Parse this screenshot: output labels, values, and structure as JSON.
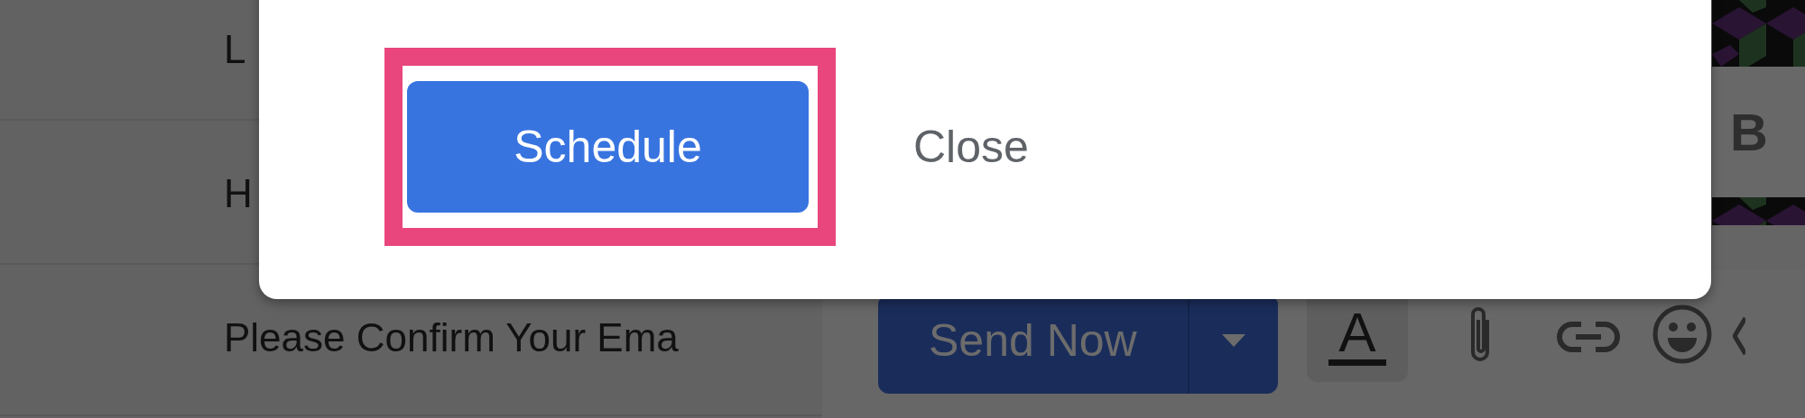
{
  "email_list": {
    "rows": [
      {
        "subject": "L"
      },
      {
        "subject": "H"
      },
      {
        "subject": "Please Confirm Your Ema"
      }
    ]
  },
  "dialog": {
    "buttons": [
      {
        "label": "Schedule",
        "kind": "primary",
        "highlighted": true
      },
      {
        "label": "Close",
        "kind": "text",
        "highlighted": false
      }
    ]
  },
  "side_panel": {
    "bold_button": "B"
  },
  "compose_toolbar": {
    "send_button": "Send Now",
    "format_button": "A"
  }
}
